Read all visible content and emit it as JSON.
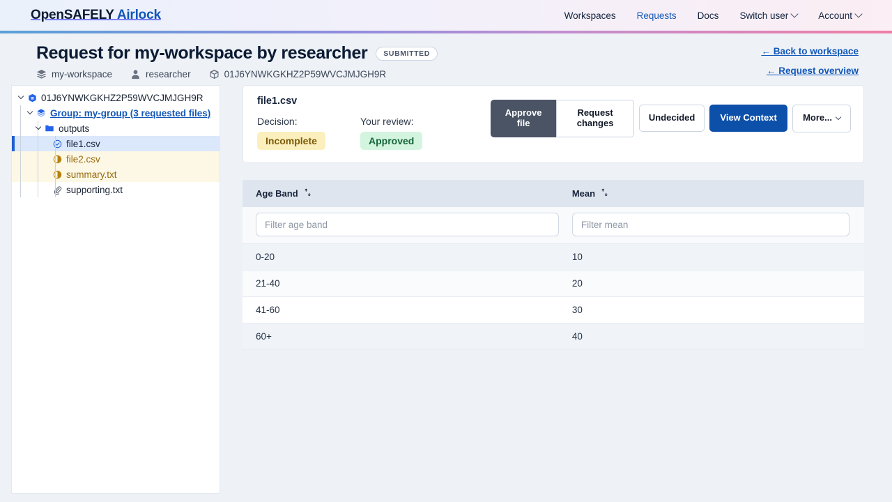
{
  "nav": {
    "brand_primary": "OpenSAFELY",
    "brand_secondary": "Airlock",
    "links": [
      {
        "label": "Workspaces",
        "active": false,
        "caret": false
      },
      {
        "label": "Requests",
        "active": true,
        "caret": false
      },
      {
        "label": "Docs",
        "active": false,
        "caret": false
      },
      {
        "label": "Switch user",
        "active": false,
        "caret": true
      },
      {
        "label": "Account",
        "active": false,
        "caret": true
      }
    ],
    "accent_blue": "#1257b8",
    "rule_gradient": [
      "#5aa0d8",
      "#8f8ede",
      "#c08fd0",
      "#ef7fa6"
    ]
  },
  "header": {
    "title": "Request for my-workspace by researcher",
    "status_badge": "SUBMITTED",
    "meta": [
      {
        "icon": "layers-icon",
        "label": "my-workspace"
      },
      {
        "icon": "user-icon",
        "label": "researcher"
      },
      {
        "icon": "box-icon",
        "label": "01J6YNWKGKHZ2P59WVCJMJGH9R"
      }
    ],
    "links": [
      {
        "label": "← Back to workspace"
      },
      {
        "label": "← Request overview"
      }
    ]
  },
  "tree": {
    "nodes": [
      {
        "level": 0,
        "icon": "request-icon",
        "label": "01J6YNWKGKHZ2P59WVCJMJGH9R",
        "style": "plain",
        "twisty": true,
        "row": "none"
      },
      {
        "level": 1,
        "icon": "group-icon",
        "label": "Group: my-group (3 requested files)",
        "style": "link",
        "twisty": true,
        "row": "none"
      },
      {
        "level": 2,
        "icon": "folder-icon",
        "label": "outputs",
        "style": "plain",
        "twisty": true,
        "row": "none"
      },
      {
        "level": 3,
        "icon": "check-circle-icon",
        "label": "file1.csv",
        "style": "selected",
        "twisty": false,
        "row": "sel"
      },
      {
        "level": 3,
        "icon": "half-circle-icon",
        "label": "file2.csv",
        "style": "amber",
        "twisty": false,
        "row": "amber"
      },
      {
        "level": 3,
        "icon": "half-circle-icon",
        "label": "summary.txt",
        "style": "amber",
        "twisty": false,
        "row": "amber"
      },
      {
        "level": 3,
        "icon": "paperclip-icon",
        "label": "supporting.txt",
        "style": "plain",
        "twisty": false,
        "row": "none"
      }
    ]
  },
  "file_card": {
    "file_name": "file1.csv",
    "decision_label": "Decision:",
    "decision_value": "Incomplete",
    "review_label": "Your review:",
    "review_value": "Approved",
    "buttons": {
      "approve": "Approve file",
      "request_changes": "Request changes",
      "undecided": "Undecided",
      "view_context": "View Context",
      "more": "More..."
    },
    "colors": {
      "incomplete_bg": "#fbf0bd",
      "incomplete_fg": "#7c5a08",
      "approved_bg": "#d3f5df",
      "approved_fg": "#16663a",
      "approve_btn_bg": "#4a5465",
      "primary_btn_bg": "#0d50aa"
    }
  },
  "chart_data": {
    "type": "table",
    "title": "file1.csv",
    "columns": [
      "Age Band",
      "Mean"
    ],
    "filters": [
      "Filter age band",
      "Filter mean"
    ],
    "categories": [
      "0-20",
      "21-40",
      "41-60",
      "60+"
    ],
    "values": [
      10,
      20,
      30,
      40
    ],
    "rows": [
      [
        "0-20",
        "10"
      ],
      [
        "21-40",
        "20"
      ],
      [
        "41-60",
        "30"
      ],
      [
        "60+",
        "40"
      ]
    ],
    "xlabel": "Age Band",
    "ylabel": "Mean"
  }
}
